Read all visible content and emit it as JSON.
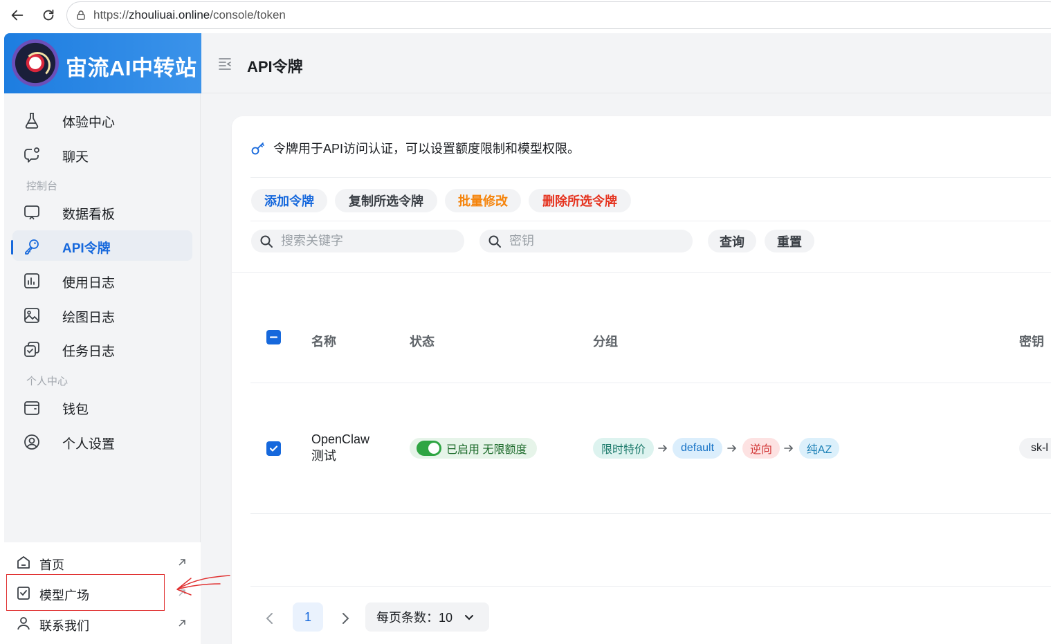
{
  "browser": {
    "url_prefix": "https://",
    "url_host": "zhouliuai.online",
    "url_path": "/console/token"
  },
  "brand": {
    "name": "宙流AI中转站"
  },
  "header": {
    "title": "API令牌"
  },
  "sidebar": {
    "items": [
      {
        "label": "体验中心",
        "icon": "flask-icon"
      },
      {
        "label": "聊天",
        "icon": "chat-icon"
      }
    ],
    "section_console": "控制台",
    "console_items": [
      {
        "label": "数据看板",
        "icon": "monitor-icon"
      },
      {
        "label": "API令牌",
        "icon": "key-icon",
        "active": true
      },
      {
        "label": "使用日志",
        "icon": "chart-log-icon"
      },
      {
        "label": "绘图日志",
        "icon": "image-icon"
      },
      {
        "label": "任务日志",
        "icon": "task-icon"
      }
    ],
    "section_personal": "个人中心",
    "personal_items": [
      {
        "label": "钱包",
        "icon": "wallet-icon"
      },
      {
        "label": "个人设置",
        "icon": "user-circle-icon"
      }
    ],
    "bottom_links": [
      {
        "label": "首页",
        "icon": "home-icon"
      },
      {
        "label": "模型广场",
        "icon": "model-icon"
      },
      {
        "label": "联系我们",
        "icon": "user-icon"
      }
    ]
  },
  "main": {
    "notice": "令牌用于API访问认证，可以设置额度限制和模型权限。",
    "actions": {
      "add": "添加令牌",
      "copy": "复制所选令牌",
      "batch_edit": "批量修改",
      "delete": "删除所选令牌"
    },
    "search": {
      "keyword_placeholder": "搜索关键字",
      "key_placeholder": "密钥",
      "query": "查询",
      "reset": "重置"
    },
    "table": {
      "columns": [
        "名称",
        "状态",
        "分组",
        "密钥"
      ],
      "rows": [
        {
          "name_line1": "OpenClaw",
          "name_line2": "测试",
          "status": "已启用 无限额度",
          "groups": [
            "限时特价",
            "default",
            "逆向",
            "纯AZ"
          ],
          "key": "sk-l"
        }
      ]
    },
    "pagination": {
      "current_page": "1",
      "page_size_label": "每页条数：10"
    }
  },
  "colors": {
    "brand_blue": "#1d7de0",
    "accent": "#1668dc",
    "batch_edit_orange": "#f5840c",
    "delete_red": "#e5331f",
    "enabled_green": "#2fa543"
  }
}
